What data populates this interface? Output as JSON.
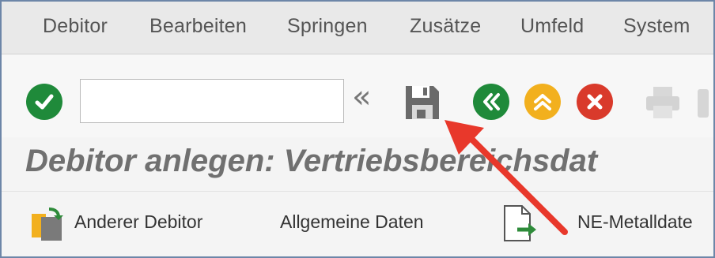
{
  "menubar": {
    "items": [
      "Debitor",
      "Bearbeiten",
      "Springen",
      "Zusätze",
      "Umfeld",
      "System"
    ]
  },
  "toolbar": {
    "command_field": {
      "value": "",
      "placeholder": ""
    },
    "expand_label": "«",
    "icons": {
      "enter": "check-icon",
      "save": "save-icon",
      "back": "back-icon",
      "exit": "exit-icon",
      "cancel": "cancel-icon",
      "print": "print-icon"
    },
    "colors": {
      "enter": "#1f8a3a",
      "back": "#1f8a3a",
      "exit": "#f2b01e",
      "cancel": "#d93a2b",
      "highlight_arrow": "#e8382b"
    }
  },
  "title": {
    "text": "Debitor anlegen: Vertriebsbereichsdat"
  },
  "app_toolbar": {
    "other_customer": "Anderer Debitor",
    "general_data": "Allgemeine Daten",
    "nonferrous": "NE-Metalldate"
  }
}
